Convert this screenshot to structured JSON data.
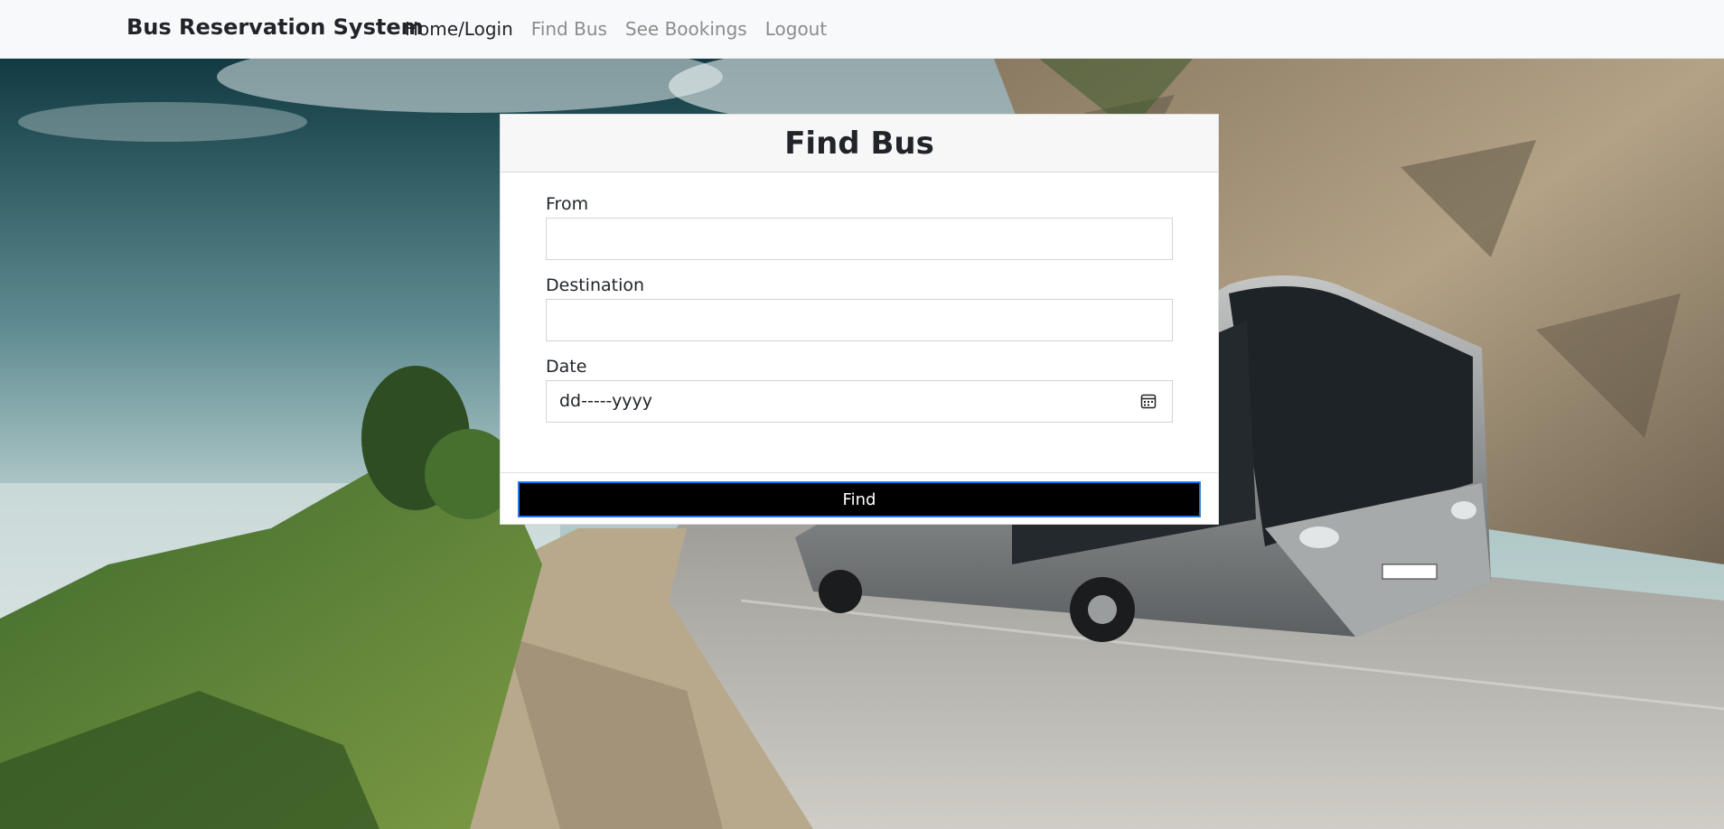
{
  "navbar": {
    "brand": "Bus Reservation System",
    "links": [
      {
        "label": "Home/Login",
        "active": true
      },
      {
        "label": "Find Bus",
        "active": false
      },
      {
        "label": "See Bookings",
        "active": false
      },
      {
        "label": "Logout",
        "active": false
      }
    ]
  },
  "form": {
    "title": "Find Bus",
    "from": {
      "label": "From",
      "value": ""
    },
    "destination": {
      "label": "Destination",
      "value": ""
    },
    "date": {
      "label": "Date",
      "placeholder": "dd-----yyyy"
    },
    "submit_label": "Find"
  },
  "colors": {
    "navbar_bg": "#f8f9fa",
    "button_bg": "#000000",
    "button_border": "#0d6efd"
  }
}
